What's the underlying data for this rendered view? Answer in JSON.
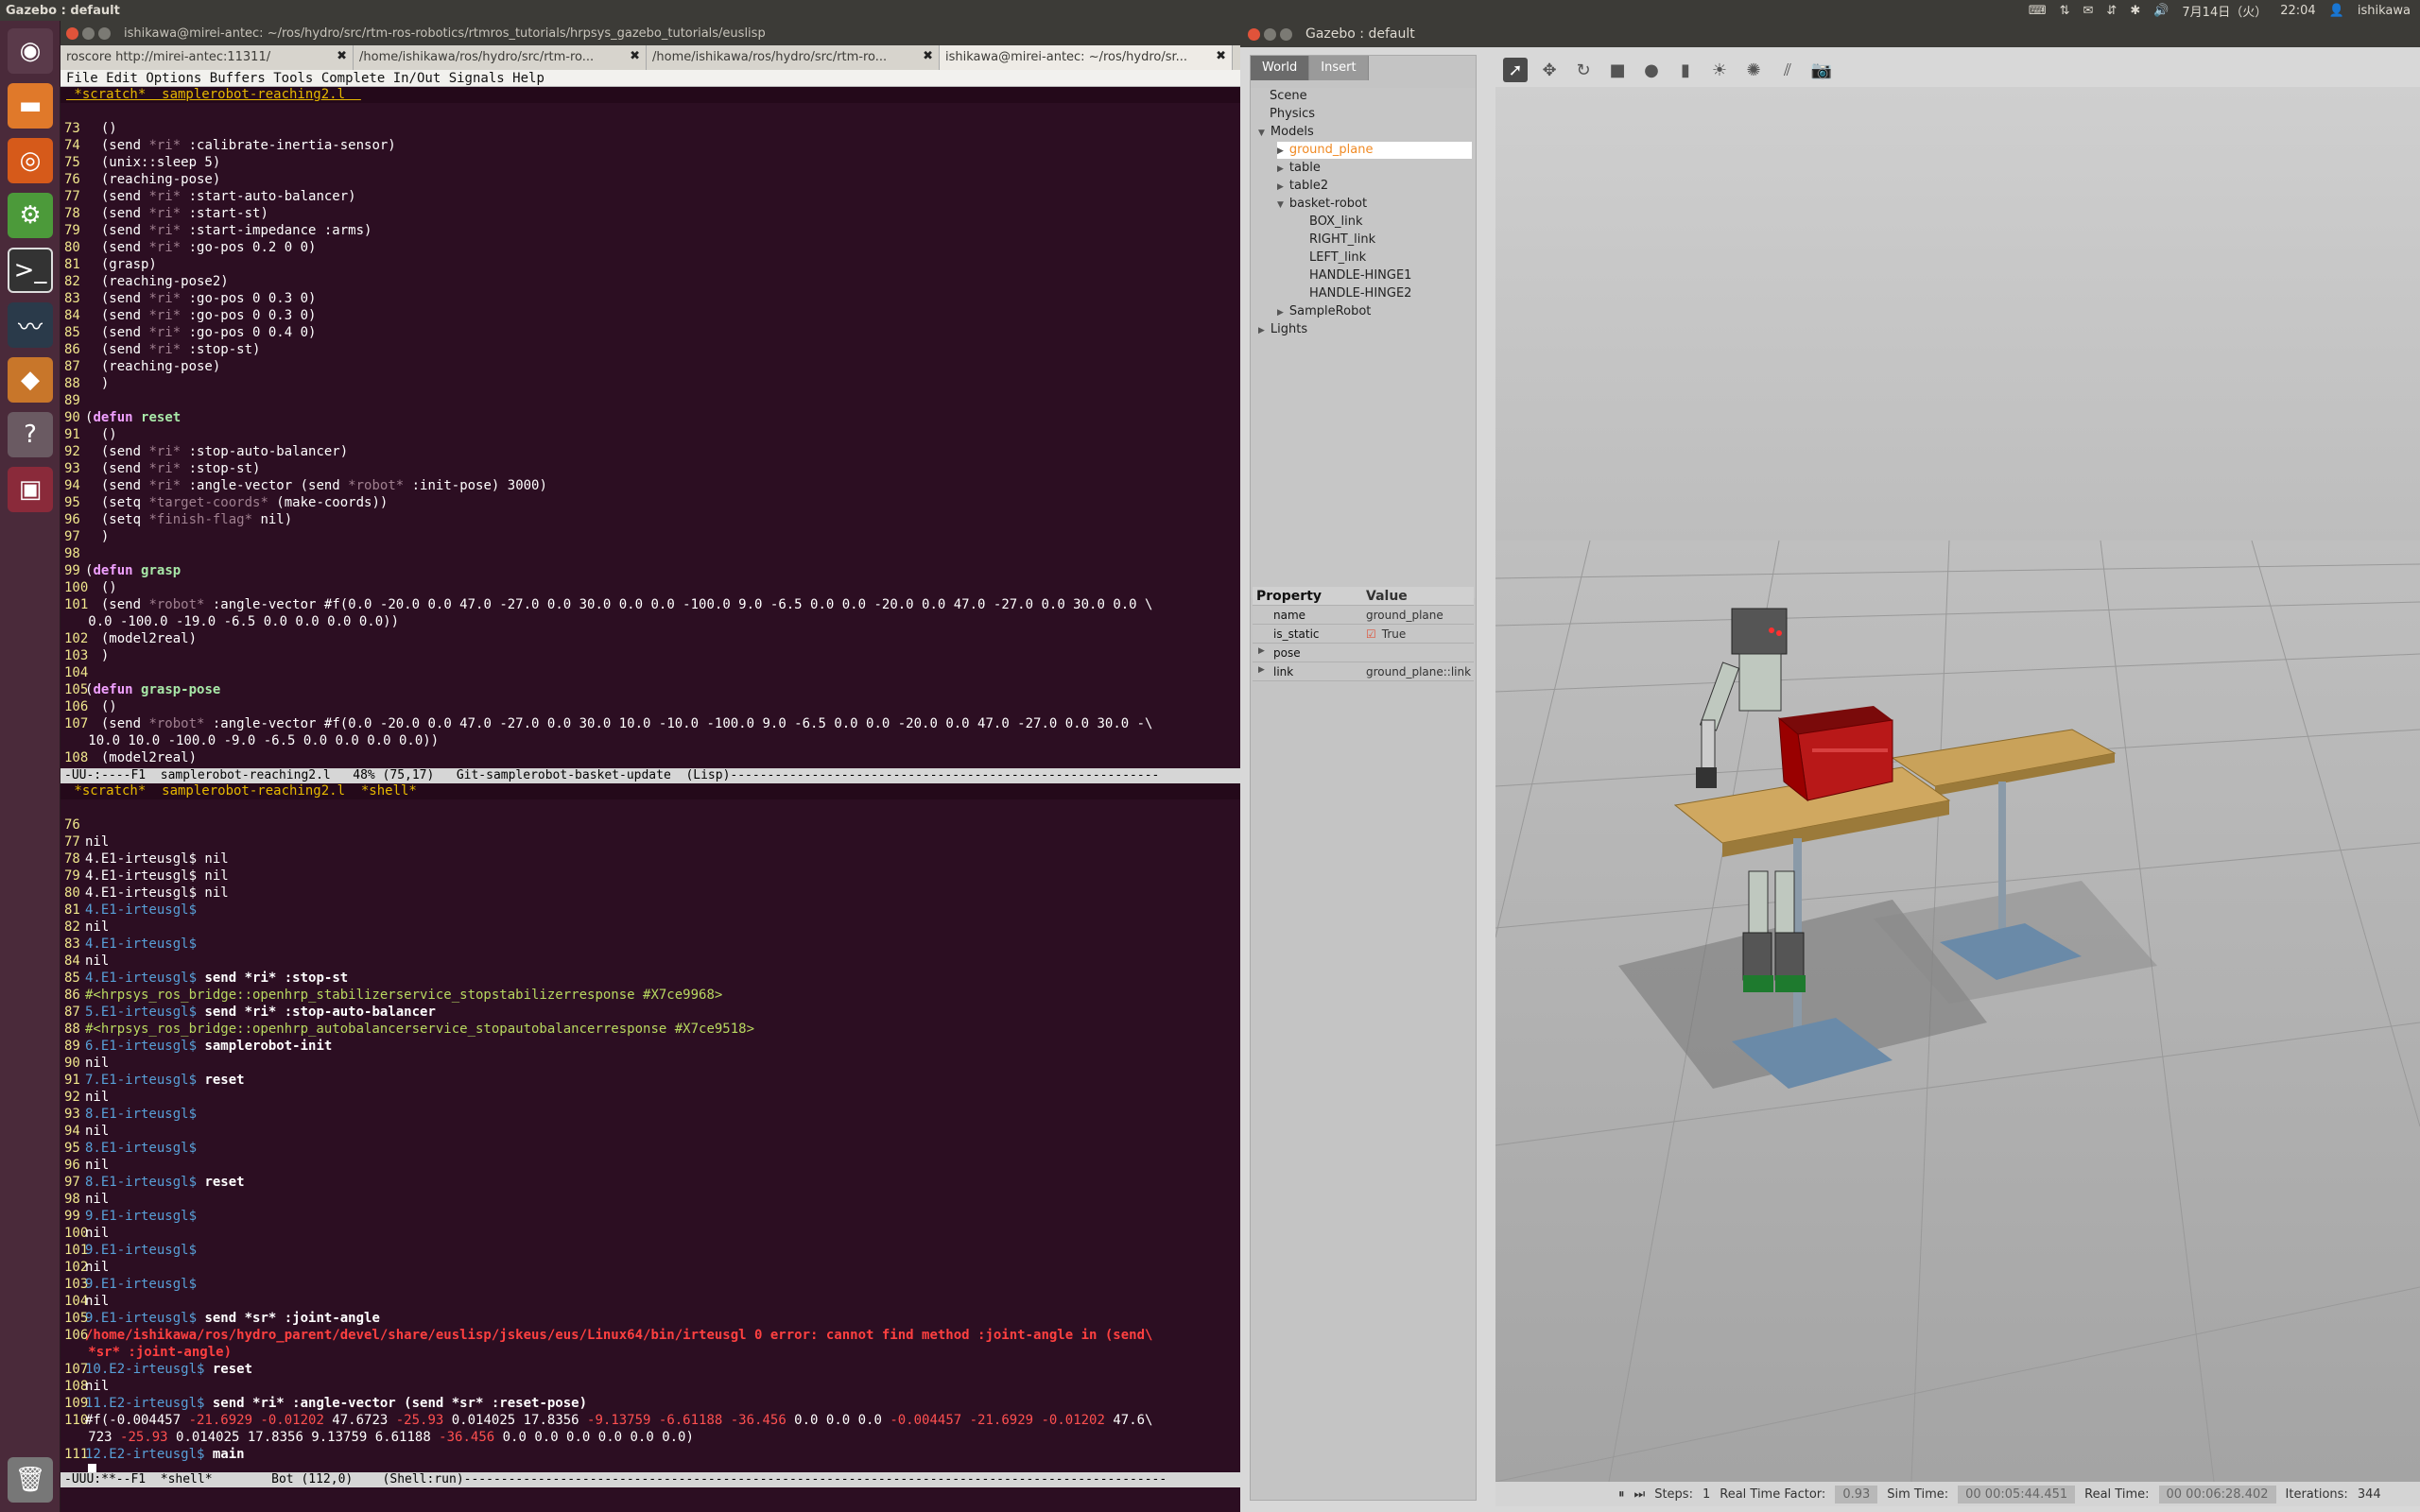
{
  "top_panel": {
    "title": "Gazebo : default",
    "date": "7月14日（火）",
    "time": "22:04",
    "user": "ishikawa"
  },
  "terminal": {
    "title": "ishikawa@mirei-antec: ~/ros/hydro/src/rtm-ros-robotics/rtmros_tutorials/hrpsys_gazebo_tutorials/euslisp",
    "tabs": [
      {
        "label": "roscore http://mirei-antec:11311/"
      },
      {
        "label": "/home/ishikawa/ros/hydro/src/rtm-ro..."
      },
      {
        "label": "/home/ishikawa/ros/hydro/src/rtm-ro..."
      },
      {
        "label": "ishikawa@mirei-antec: ~/ros/hydro/sr..."
      }
    ],
    "menu": [
      "File",
      "Edit",
      "Options",
      "Buffers",
      "Tools",
      "Complete",
      "In/Out",
      "Signals",
      "Help"
    ],
    "top_buffer_line": " *scratch*  samplerobot-reaching2.l  ",
    "mid_buffer_line": " *scratch*  samplerobot-reaching2.l  *shell*  ",
    "modeline1": "-UU-:----F1  samplerobot-reaching2.l   48% (75,17)   Git-samplerobot-basket-update  (Lisp)----------------------------------------------------------",
    "modeline2": "-UUU:**--F1  *shell*        Bot (112,0)    (Shell:run)-----------------------------------------------------------------------------------------------"
  },
  "gazebo": {
    "title": "Gazebo : default",
    "tabs": [
      "World",
      "Insert"
    ],
    "tree": [
      {
        "label": "Scene",
        "indent": 0,
        "arrow": ""
      },
      {
        "label": "Physics",
        "indent": 0,
        "arrow": ""
      },
      {
        "label": "Models",
        "indent": 0,
        "arrow": "▼"
      },
      {
        "label": "ground_plane",
        "indent": 1,
        "arrow": "▶",
        "selected": true
      },
      {
        "label": "table",
        "indent": 1,
        "arrow": "▶"
      },
      {
        "label": "table2",
        "indent": 1,
        "arrow": "▶"
      },
      {
        "label": "basket-robot",
        "indent": 1,
        "arrow": "▼"
      },
      {
        "label": "BOX_link",
        "indent": 2,
        "arrow": ""
      },
      {
        "label": "RIGHT_link",
        "indent": 2,
        "arrow": ""
      },
      {
        "label": "LEFT_link",
        "indent": 2,
        "arrow": ""
      },
      {
        "label": "HANDLE-HINGE1",
        "indent": 2,
        "arrow": ""
      },
      {
        "label": "HANDLE-HINGE2",
        "indent": 2,
        "arrow": ""
      },
      {
        "label": "SampleRobot",
        "indent": 1,
        "arrow": "▶"
      },
      {
        "label": "Lights",
        "indent": 0,
        "arrow": "▶"
      }
    ],
    "props_header": {
      "property": "Property",
      "value": "Value"
    },
    "props": [
      {
        "key": "name",
        "value": "ground_plane",
        "arrow": ""
      },
      {
        "key": "is_static",
        "value": "True",
        "arrow": ""
      },
      {
        "key": "pose",
        "value": "",
        "arrow": "▶"
      },
      {
        "key": "link",
        "value": "ground_plane::link",
        "arrow": "▶"
      }
    ],
    "bottom": {
      "steps_label": "Steps:",
      "steps_value": "1",
      "rtf_label": "Real Time Factor:",
      "rtf_value": "0.93",
      "sim_label": "Sim Time:",
      "sim_value": "00 00:05:44.451",
      "real_label": "Real Time:",
      "real_value": "00 00:06:28.402",
      "iter_label": "Iterations:",
      "iter_value": "344"
    }
  },
  "colors": {
    "terminal_bg": "#2c0e22",
    "gazebo_sky": "#c9c9c9",
    "accent_orange": "#f08a24"
  }
}
